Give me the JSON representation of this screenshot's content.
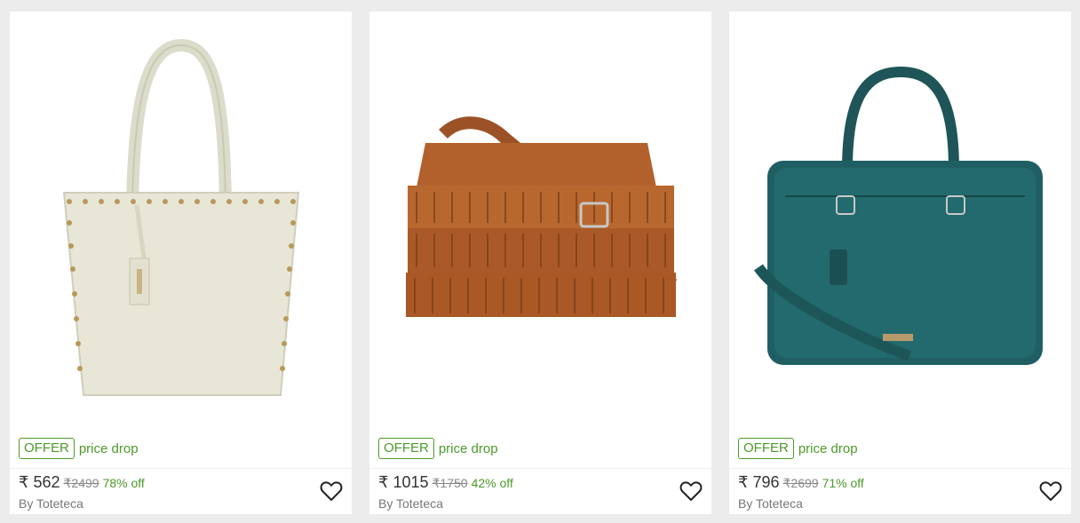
{
  "products": [
    {
      "image_name": "white-studded-tote-bag",
      "offer_badge": "OFFER",
      "offer_text": "price drop",
      "price": "₹ 562",
      "mrp": "₹2499",
      "discount": "78% off",
      "brand": "By Toteteca",
      "wishlist_icon": "heart-outline-icon"
    },
    {
      "image_name": "tan-fringe-sling-bag",
      "offer_badge": "OFFER",
      "offer_text": "price drop",
      "price": "₹ 1015",
      "mrp": "₹1750",
      "discount": "42% off",
      "brand": "By Toteteca",
      "wishlist_icon": "heart-outline-icon"
    },
    {
      "image_name": "teal-laptop-bag",
      "offer_badge": "OFFER",
      "offer_text": "price drop",
      "price": "₹ 796",
      "mrp": "₹2699",
      "discount": "71% off",
      "brand": "By Toteteca",
      "wishlist_icon": "heart-outline-icon"
    }
  ],
  "colors": {
    "offer_green": "#4c9a2a",
    "page_bg": "#ececec"
  }
}
